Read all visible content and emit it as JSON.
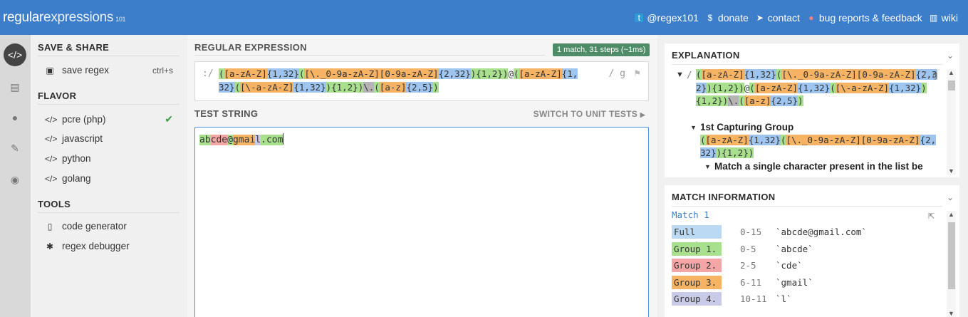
{
  "app": {
    "logo_part1": "regular",
    "logo_part2": "expressions",
    "logo_version": "101"
  },
  "topnav": [
    {
      "icon": "twitter-icon",
      "label": "@regex101"
    },
    {
      "icon": "dollar-icon",
      "label": "donate"
    },
    {
      "icon": "paper-plane-icon",
      "label": "contact"
    },
    {
      "icon": "bug-icon",
      "label": "bug reports & feedback"
    },
    {
      "icon": "bank-icon",
      "label": "wiki"
    }
  ],
  "sidebar_icons": [
    "code-icon",
    "book-icon",
    "user-icon",
    "wrench-icon",
    "chat-icon"
  ],
  "left": {
    "save_share_header": "SAVE & SHARE",
    "save_label": "save regex",
    "save_shortcut": "ctrl+s",
    "flavor_header": "FLAVOR",
    "flavors": [
      "pcre (php)",
      "javascript",
      "python",
      "golang"
    ],
    "tools_header": "TOOLS",
    "tools": [
      "code generator",
      "regex debugger"
    ]
  },
  "regex": {
    "header": "REGULAR EXPRESSION",
    "match_info": "1 match, 31 steps (~1ms)",
    "delimiter": ":/",
    "flags": "/ g",
    "tokens": [
      {
        "t": "(",
        "c": "g"
      },
      {
        "t": "[a-zA-Z]",
        "c": "o"
      },
      {
        "t": "{1,32}",
        "c": "b"
      },
      {
        "t": "(",
        "c": "g"
      },
      {
        "t": "[\\._0-9a-zA-Z][0-9a-zA-Z]",
        "c": "o"
      },
      {
        "t": "{2,32}",
        "c": "b"
      },
      {
        "t": ")",
        "c": "g"
      },
      {
        "t": "{1,2}",
        "c": "g"
      },
      {
        "t": ")",
        "c": "g"
      },
      {
        "t": "@",
        "c": ""
      },
      {
        "t": "(",
        "c": "g"
      },
      {
        "t": "[a-zA-Z]",
        "c": "o"
      },
      {
        "t": "{1,32}",
        "c": "b"
      },
      {
        "t": "(",
        "c": "g"
      },
      {
        "t": "[\\-a-zA-Z]",
        "c": "o"
      },
      {
        "t": "{1,32}",
        "c": "b"
      },
      {
        "t": ")",
        "c": "g"
      },
      {
        "t": "{1,2}",
        "c": "g"
      },
      {
        "t": ")",
        "c": "g"
      },
      {
        "t": "\\.",
        "c": "gr"
      },
      {
        "t": "(",
        "c": "g"
      },
      {
        "t": "[a-z]",
        "c": "o"
      },
      {
        "t": "{2,5}",
        "c": "b"
      },
      {
        "t": ")",
        "c": "g"
      }
    ]
  },
  "test": {
    "header": "TEST STRING",
    "unit_tests_link": "SWITCH TO UNIT TESTS",
    "segments": [
      {
        "t": "ab",
        "c": "g"
      },
      {
        "t": "cde",
        "c": "r"
      },
      {
        "t": "@",
        "c": "g"
      },
      {
        "t": "gmai",
        "c": "o"
      },
      {
        "t": "l",
        "c": "p"
      },
      {
        "t": ".",
        "c": "g"
      },
      {
        "t": "com",
        "c": "g"
      }
    ]
  },
  "explanation": {
    "header": "EXPLANATION",
    "delimiter": "/",
    "flags": "/ g",
    "group1_title": "1st Capturing Group",
    "group1_tokens": [
      {
        "t": "(",
        "c": "g"
      },
      {
        "t": "[a-zA-Z]",
        "c": "o"
      },
      {
        "t": "{1,32}",
        "c": "b"
      },
      {
        "t": "(",
        "c": "g"
      },
      {
        "t": "[\\._0-9a-zA-Z][0-9a-zA-Z]",
        "c": "o"
      },
      {
        "t": "{2,32}",
        "c": "b"
      },
      {
        "t": ")",
        "c": "g"
      },
      {
        "t": "{1,2}",
        "c": "g"
      },
      {
        "t": ")",
        "c": "g"
      }
    ],
    "item3": "Match a single character present in the list be"
  },
  "match_information": {
    "header": "MATCH INFORMATION",
    "match_title": "Match 1",
    "rows": [
      {
        "label": "Full match",
        "range": "0-15",
        "value": "`abcde@gmail.com`",
        "color": "#bcd9f4"
      },
      {
        "label": "Group 1.",
        "range": "0-5",
        "value": "`abcde`",
        "color": "#a8e08e"
      },
      {
        "label": "Group 2.",
        "range": "2-5",
        "value": "`cde`",
        "color": "#f4a5a5"
      },
      {
        "label": "Group 3.",
        "range": "6-11",
        "value": "`gmail`",
        "color": "#f6b363"
      },
      {
        "label": "Group 4.",
        "range": "10-11",
        "value": "`l`",
        "color": "#c9c9e8"
      }
    ]
  }
}
